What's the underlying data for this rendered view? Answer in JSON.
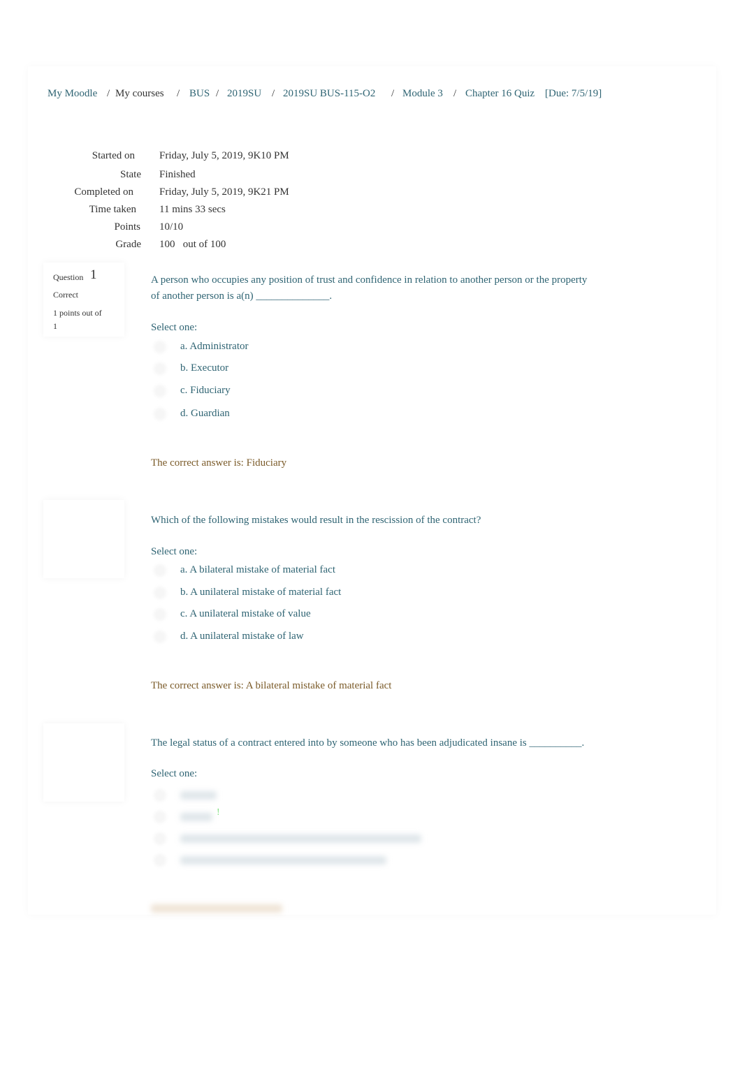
{
  "breadcrumb": [
    {
      "label": "My Moodle",
      "link": true
    },
    {
      "label": "My courses",
      "link": false
    },
    {
      "label": "BUS",
      "link": true
    },
    {
      "label": "2019SU",
      "link": true
    },
    {
      "label": "2019SU BUS-115-O2",
      "link": true
    },
    {
      "label": "Module 3",
      "link": true
    },
    {
      "label": "Chapter 16 Quiz",
      "link": true
    },
    {
      "label": "[Due: 7/5/19]",
      "link": true
    }
  ],
  "separator": "/",
  "summary": [
    {
      "label": "Started on",
      "value": "Friday, July 5, 2019, 9K10 PM"
    },
    {
      "label": "State",
      "value": "Finished"
    },
    {
      "label": "Completed on",
      "value": "Friday, July 5, 2019, 9K21 PM"
    },
    {
      "label": "Time taken",
      "value": "11 mins 33 secs"
    },
    {
      "label": "Points",
      "value": "10/10"
    },
    {
      "label": "Grade",
      "value": "100   out of 100"
    }
  ],
  "questions": [
    {
      "label": "Question",
      "number": "1",
      "state": "Correct",
      "points": "1 points out of",
      "points2": "1",
      "text": "A person who occupies any position of trust and confidence in relation to another person or the property of another person is a(n) ______________.",
      "select": "Select one:",
      "options": [
        "a. Administrator",
        "b. Executor",
        "c. Fiduciary",
        "d. Guardian"
      ],
      "answer": "The correct answer is: Fiduciary"
    },
    {
      "text": "Which of the following mistakes would result in the rescission of the contract?",
      "select": "Select one:",
      "options": [
        "a. A bilateral mistake of material fact",
        "b. A unilateral mistake of material fact",
        "c. A unilateral mistake of value",
        "d. A unilateral mistake of law"
      ],
      "answer": "The correct answer is: A bilateral mistake of material fact"
    },
    {
      "text": "The legal status of a contract entered into by someone who has been adjudicated insane is __________.",
      "select": "Select one:",
      "mark": "!"
    }
  ],
  "colors": {
    "link": "#2f6473",
    "answer": "#7a5a28",
    "mark": "#7fe07f"
  }
}
